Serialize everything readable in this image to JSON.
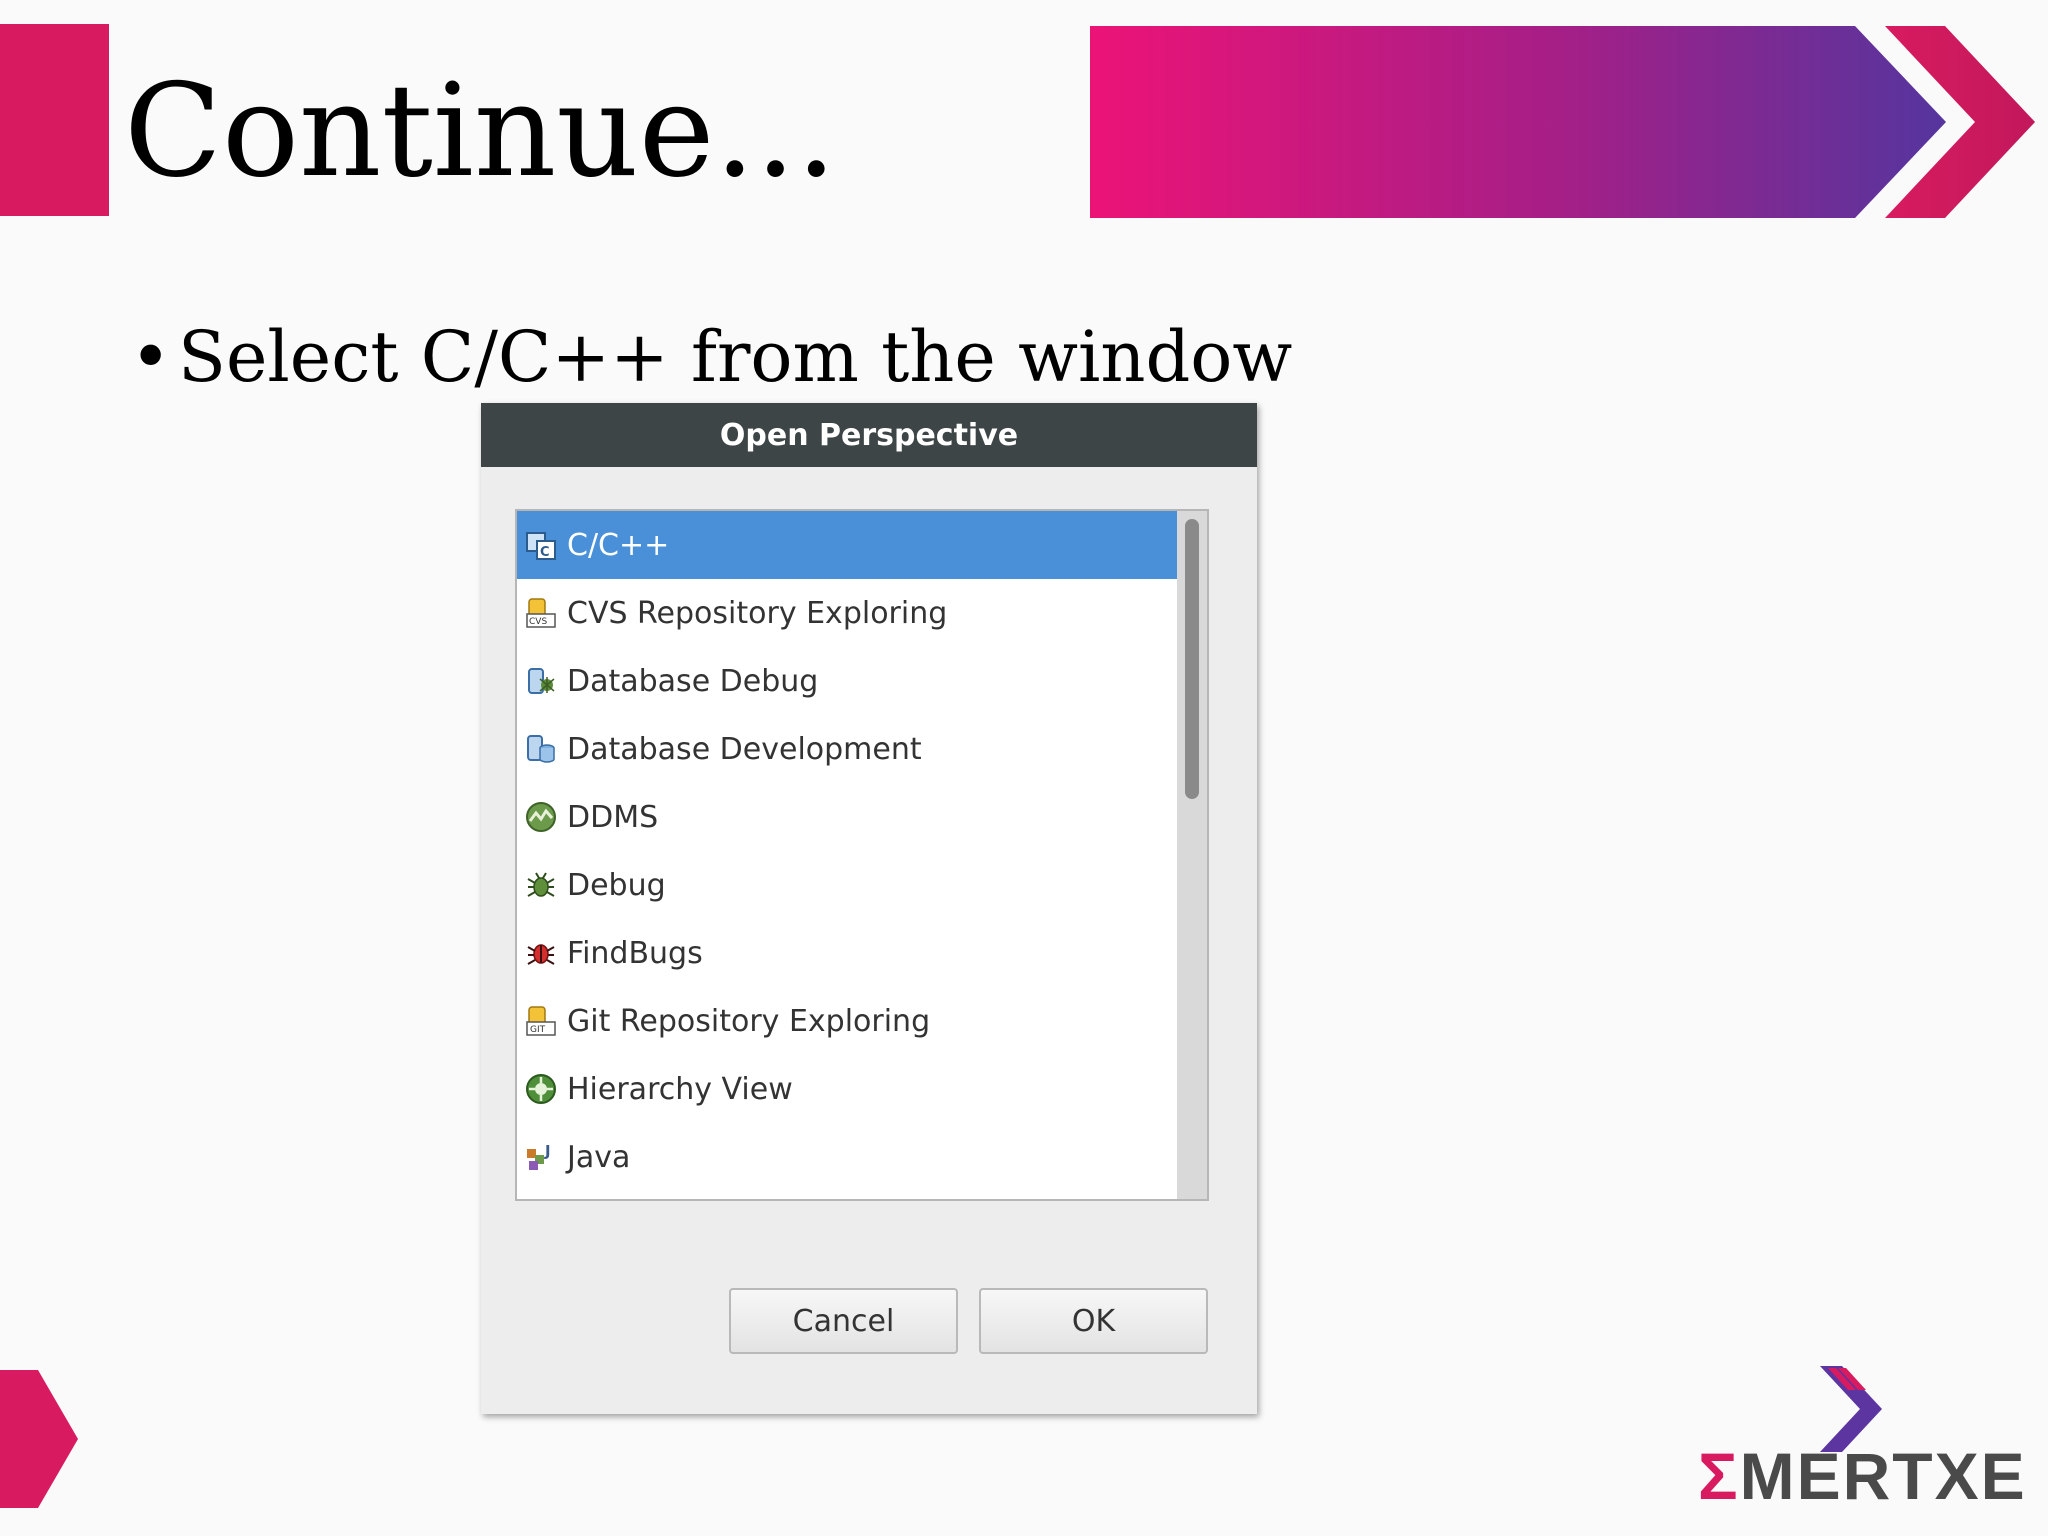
{
  "slide": {
    "title": "Continue...",
    "bullet": "Select C/C++ from the window"
  },
  "dialog": {
    "title": "Open Perspective",
    "items": [
      {
        "label": "C/C++",
        "icon": "cpp-perspective-icon",
        "selected": true
      },
      {
        "label": "CVS Repository Exploring",
        "icon": "cvs-repository-icon",
        "selected": false
      },
      {
        "label": "Database Debug",
        "icon": "database-debug-icon",
        "selected": false
      },
      {
        "label": "Database Development",
        "icon": "database-development-icon",
        "selected": false
      },
      {
        "label": "DDMS",
        "icon": "ddms-icon",
        "selected": false
      },
      {
        "label": "Debug",
        "icon": "debug-bug-icon",
        "selected": false
      },
      {
        "label": "FindBugs",
        "icon": "findbugs-icon",
        "selected": false
      },
      {
        "label": "Git Repository Exploring",
        "icon": "git-repository-icon",
        "selected": false
      },
      {
        "label": "Hierarchy View",
        "icon": "hierarchy-view-icon",
        "selected": false
      },
      {
        "label": "Java",
        "icon": "java-perspective-icon",
        "selected": false
      }
    ],
    "cancel_label": "Cancel",
    "ok_label": "OK"
  },
  "logo": {
    "sigma": "Σ",
    "text": "MERTXE"
  },
  "colors": {
    "accent_pink": "#d81b60",
    "accent_purple": "#5c35a0",
    "selection_blue": "#4a90d9",
    "titlebar": "#3e4546"
  }
}
